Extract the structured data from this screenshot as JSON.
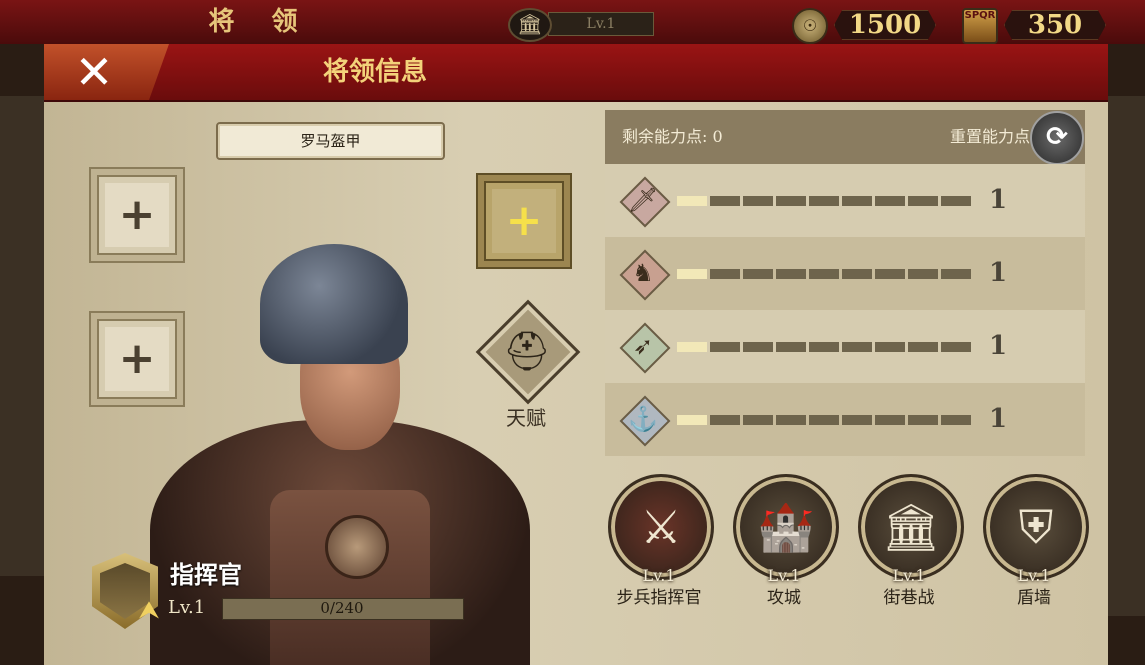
{
  "topbar": {
    "title": "将 领",
    "building_level": "Lv.1",
    "building_icon": "temple-icon",
    "resources": [
      {
        "icon": "coin-icon",
        "value": "1500"
      },
      {
        "icon": "spqr-emblem-icon",
        "emblem_text": "SPQR",
        "value": "350"
      }
    ]
  },
  "dialog": {
    "title": "将领信息",
    "close_icon": "close-icon",
    "armor_name": "罗马盔甲",
    "equipment_slots": [
      {
        "icon": "plus-icon",
        "state": "empty"
      },
      {
        "icon": "plus-icon",
        "state": "empty"
      },
      {
        "icon": "plus-icon",
        "state": "available",
        "highlight_color": "#f6e04a"
      }
    ],
    "talent_label": "天赋",
    "talent_icon": "helmet-icon",
    "commander": {
      "name": "指挥官",
      "level": "Lv.1",
      "xp_text": "0/240",
      "xp_fraction": 0
    },
    "stats": {
      "remaining_points_label": "剩余能力点: 0",
      "reset_label": "重置能力点",
      "reset_icon": "refresh-icon",
      "rows": [
        {
          "icon": "sword-icon",
          "value": "1",
          "filled_segments": 1,
          "total_segments": 9
        },
        {
          "icon": "horse-icon",
          "value": "1",
          "filled_segments": 1,
          "total_segments": 9
        },
        {
          "icon": "bow-icon",
          "value": "1",
          "filled_segments": 1,
          "total_segments": 9
        },
        {
          "icon": "anchor-icon",
          "value": "1",
          "filled_segments": 1,
          "total_segments": 9
        }
      ]
    },
    "skills": [
      {
        "icon": "crossed-swords-icon",
        "level": "Lv.1",
        "name": "步兵指挥官",
        "color": "#6a3428"
      },
      {
        "icon": "siege-wall-icon",
        "level": "Lv.1",
        "name": "攻城",
        "color": "#5a4e3c"
      },
      {
        "icon": "city-street-icon",
        "level": "Lv.1",
        "name": "街巷战",
        "color": "#5a4e3c"
      },
      {
        "icon": "shield-wall-icon",
        "level": "Lv.1",
        "name": "盾墙",
        "color": "#5a4e3c"
      }
    ]
  },
  "colors": {
    "accent_red": "#7a1414",
    "gold_text": "#f3d27a",
    "bar_fill": "#f2e8b8",
    "bar_empty": "#6e644c"
  }
}
